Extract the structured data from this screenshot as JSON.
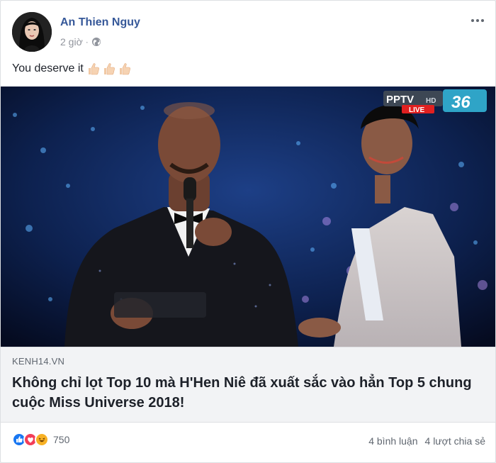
{
  "post": {
    "author": "An Thien Nguy",
    "time": "2 giờ",
    "separator": "·",
    "text": "You deserve it",
    "emoji": "thumbs-up-light-skin"
  },
  "video": {
    "channel_logo": "PPTV",
    "channel_hd": "HD",
    "channel_live": "LIVE",
    "channel_number": "36"
  },
  "link": {
    "domain": "KENH14.VN",
    "title": "Không chỉ lọt Top 10 mà H'Hen Niê đã xuất sắc vào hẳn Top 5 chung cuộc Miss Universe 2018!"
  },
  "footer": {
    "reaction_count": "750",
    "comments": "4 bình luận",
    "shares": "4 lượt chia sẻ",
    "reaction_icons": [
      "like-icon",
      "love-icon",
      "haha-icon"
    ]
  },
  "colors": {
    "author": "#365899",
    "like": "#1877f2",
    "love": "#f33e58",
    "haha": "#f7b125",
    "live": "#e02020",
    "channel": "#2fa4c7"
  }
}
